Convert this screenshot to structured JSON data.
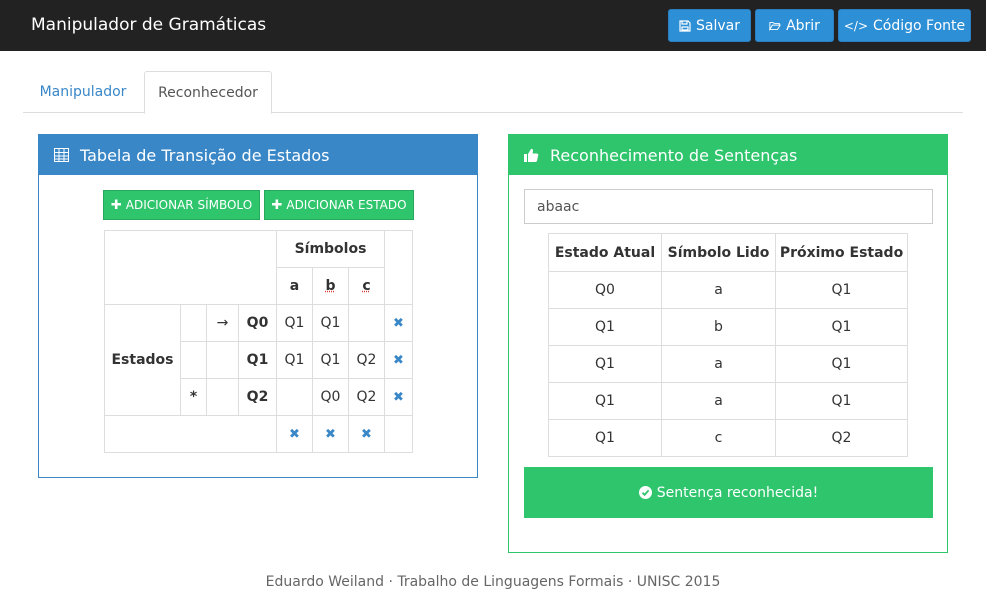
{
  "header": {
    "title": "Manipulador de Gramáticas",
    "save_label": "Salvar",
    "open_label": "Abrir",
    "source_label": "Código Fonte"
  },
  "tabs": [
    {
      "label": "Manipulador",
      "active": false
    },
    {
      "label": "Reconhecedor",
      "active": true
    }
  ],
  "left_panel": {
    "title": "Tabela de Transição de Estados",
    "add_symbol_label": "ADICIONAR SÍMBOLO",
    "add_state_label": "ADICIONAR ESTADO",
    "table": {
      "symbols_header": "Símbolos",
      "states_header": "Estados",
      "symbols": [
        "a",
        "b",
        "c"
      ],
      "rows": [
        {
          "final": "",
          "initial": "→",
          "state": "Q0",
          "cells": [
            "Q1",
            "Q1",
            ""
          ]
        },
        {
          "final": "",
          "initial": "",
          "state": "Q1",
          "cells": [
            "Q1",
            "Q1",
            "Q2"
          ]
        },
        {
          "final": "*",
          "initial": "",
          "state": "Q2",
          "cells": [
            "",
            "Q0",
            "Q2"
          ]
        }
      ],
      "remove_glyph": "✖"
    }
  },
  "right_panel": {
    "title": "Reconhecimento de Sentenças",
    "sentence_value": "abaac",
    "columns": [
      "Estado Atual",
      "Símbolo Lido",
      "Próximo Estado"
    ],
    "rows": [
      [
        "Q0",
        "a",
        "Q1"
      ],
      [
        "Q1",
        "b",
        "Q1"
      ],
      [
        "Q1",
        "a",
        "Q1"
      ],
      [
        "Q1",
        "a",
        "Q1"
      ],
      [
        "Q1",
        "c",
        "Q2"
      ]
    ],
    "result": "Sentença reconhecida!"
  },
  "footer": "Eduardo Weiland · Trabalho de Linguagens Formais · UNISC 2015",
  "colors": {
    "primary": "#3a87c8",
    "success": "#2ec56d",
    "navbar": "#222222",
    "nav_button": "#2d8fd5"
  }
}
